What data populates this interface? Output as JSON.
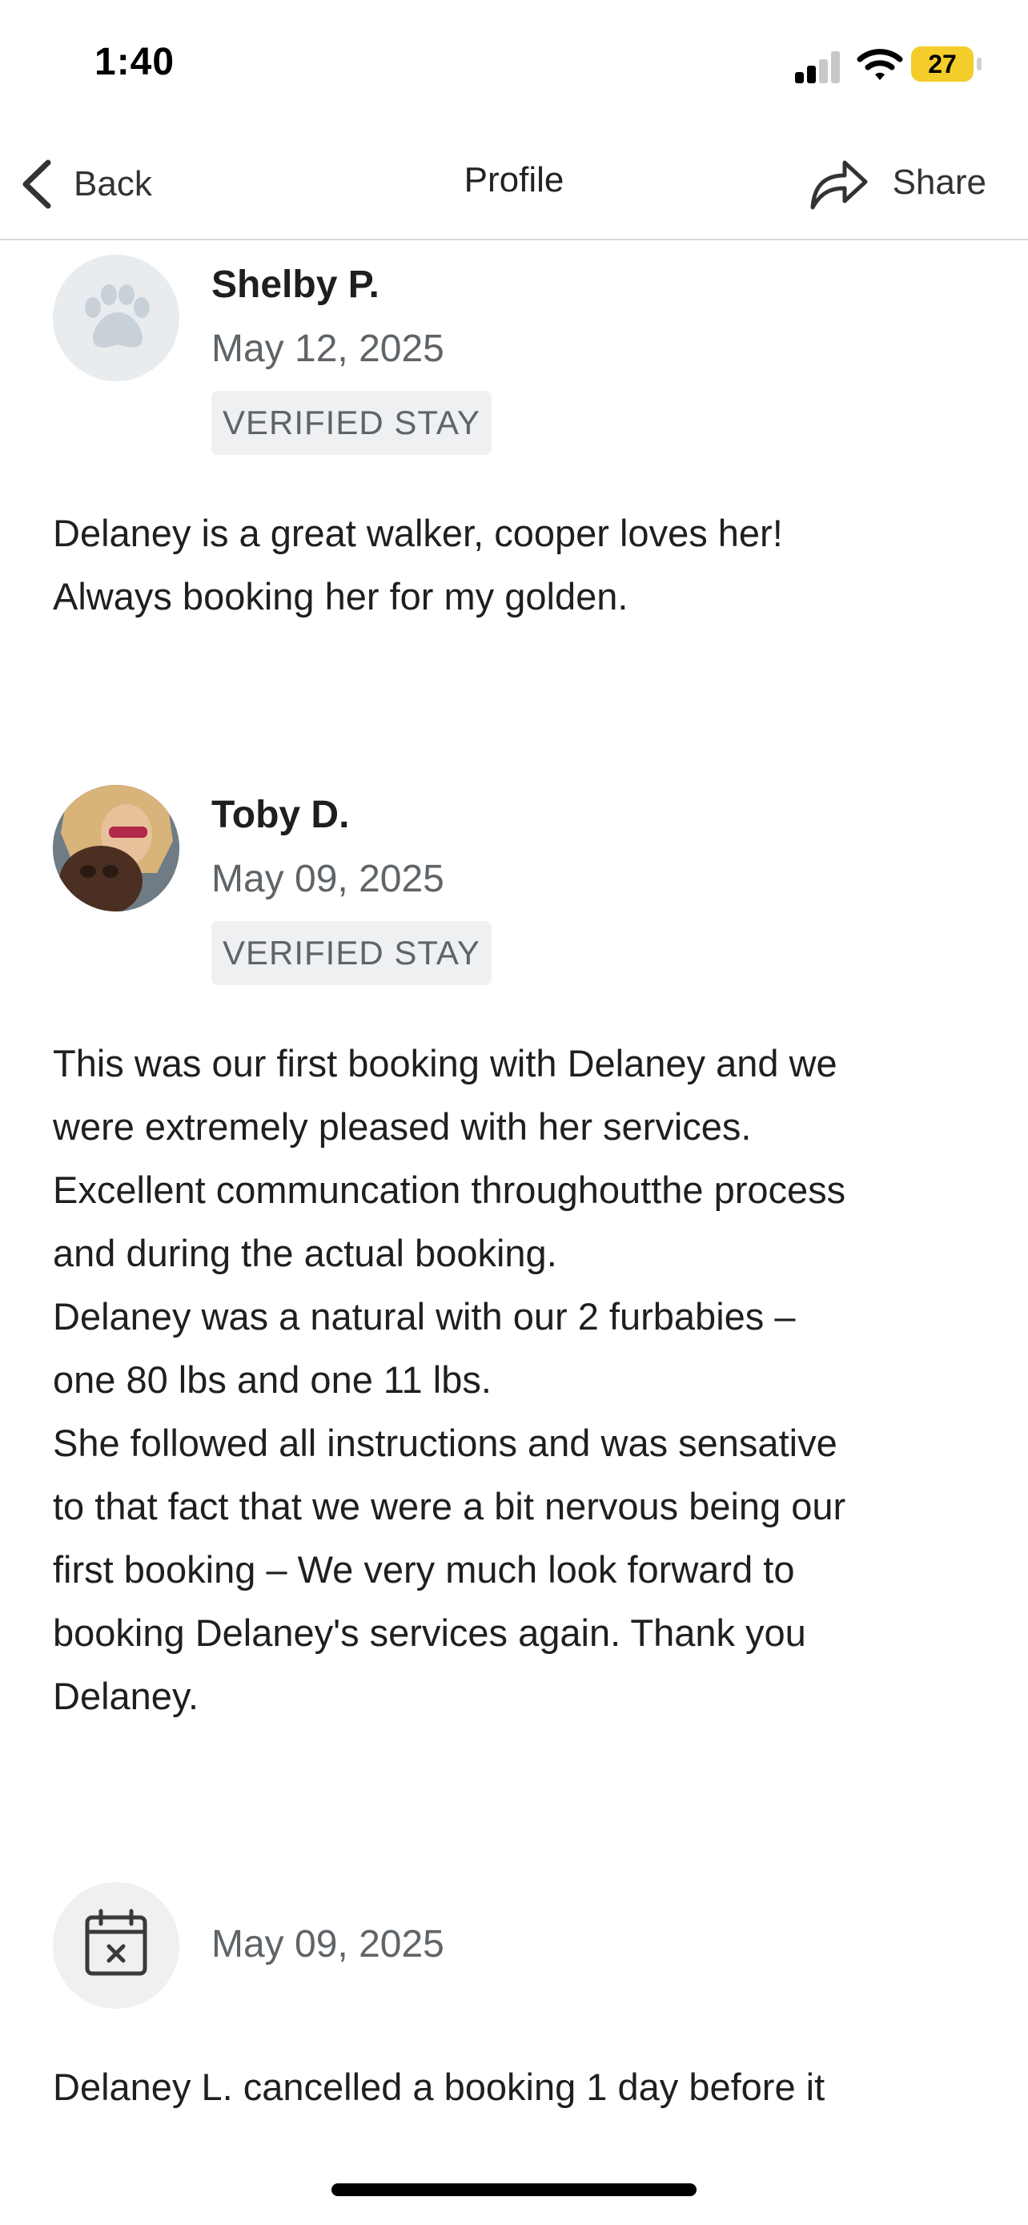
{
  "status_bar": {
    "time": "1:40",
    "battery": "27",
    "battery_color": "#f4cd2a"
  },
  "nav": {
    "back_label": "Back",
    "title": "Profile",
    "share_label": "Share"
  },
  "reviews": [
    {
      "name": "Shelby P.",
      "date": "May 12, 2025",
      "badge": "VERIFIED STAY",
      "avatar_icon": "paw-icon",
      "text": "Delaney is a great walker, cooper loves her!\nAlways booking her for my golden."
    },
    {
      "name": "Toby D.",
      "date": "May 09, 2025",
      "badge": "VERIFIED STAY",
      "avatar_icon": "photo-avatar",
      "text": "This was our first booking with Delaney and we\nwere extremely pleased with her services.\nExcellent communcation throughoutthe process\nand during the actual booking.\nDelaney was a natural with our 2 furbabies –\none 80 lbs and one 11 lbs.\nShe followed all instructions and was sensative\nto that fact that we were a bit nervous being our\nfirst booking  – We very much look forward to\nbooking Delaney's services again. Thank you\nDelaney."
    },
    {
      "date": "May 09, 2025",
      "avatar_icon": "calendar-cancel-icon",
      "text": "Delaney L. cancelled a booking 1 day before it"
    }
  ]
}
